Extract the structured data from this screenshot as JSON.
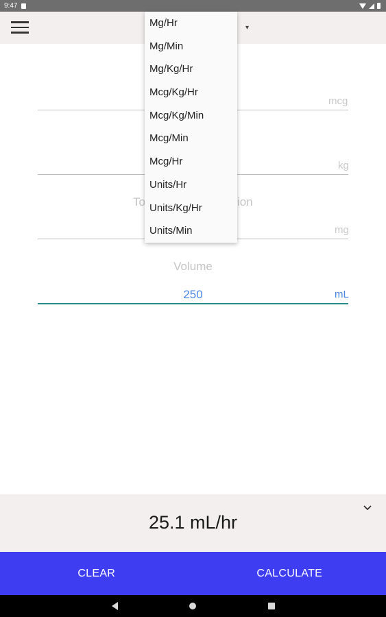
{
  "status_bar": {
    "time": "9:47"
  },
  "dropdown": {
    "items": [
      "Mg/Hr",
      "Mg/Min",
      "Mg/Kg/Hr",
      "Mcg/Kg/Hr",
      "Mcg/Kg/Min",
      "Mcg/Min",
      "Mcg/Hr",
      "Units/Hr",
      "Units/Kg/Hr",
      "Units/Min"
    ]
  },
  "form": {
    "dose_unit": "mcg",
    "weight_unit": "kg",
    "total_label_left": "To",
    "total_label_right": "ion",
    "total_unit": "mg",
    "volume_label": "Volume",
    "volume_value": "250",
    "volume_unit": "mL"
  },
  "result": {
    "value": "25.1 mL/hr"
  },
  "buttons": {
    "clear": "CLEAR",
    "calculate": "CALCULATE"
  }
}
